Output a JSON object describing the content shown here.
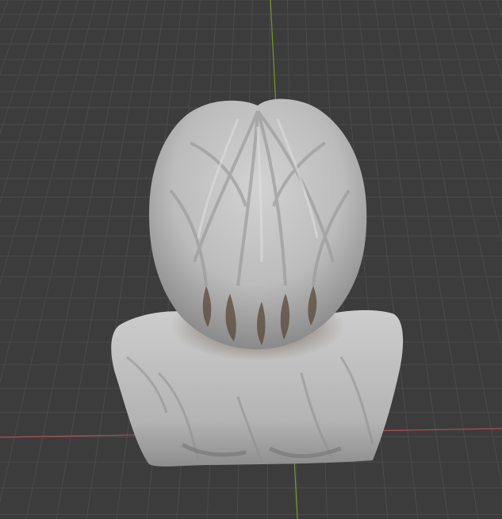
{
  "viewport": {
    "background_color": "#3c3c3c",
    "grid_color": "#4b4b4b",
    "x_axis_color": "#b64b56",
    "y_axis_color": "#6e9a2a",
    "model_color": "#c9c9c9",
    "model_shadow_color": "#5a4a3a",
    "object": "sculpted-bust-back-view"
  }
}
